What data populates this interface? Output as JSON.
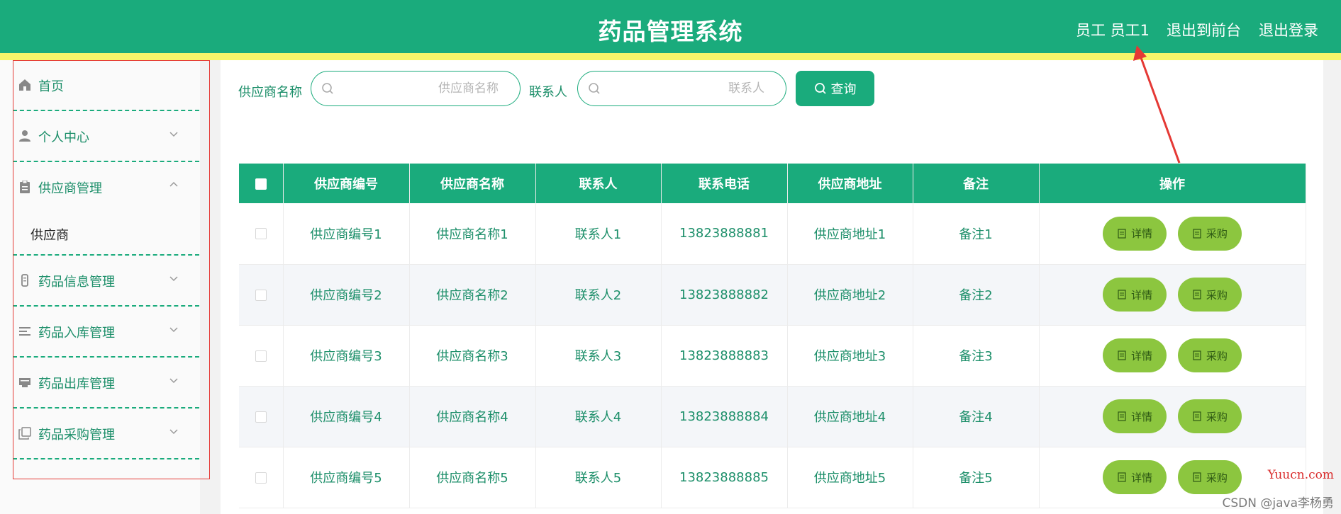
{
  "header": {
    "title": "药品管理系统",
    "user_label": "员工 员工1",
    "front_link": "退出到前台",
    "logout_link": "退出登录"
  },
  "sidebar": {
    "items": [
      {
        "label": "首页",
        "icon": "home-icon"
      },
      {
        "label": "个人中心",
        "icon": "user-icon"
      },
      {
        "label": "供应商管理",
        "icon": "clipboard-icon",
        "expanded": true
      },
      {
        "label": "药品信息管理",
        "icon": "vial-icon"
      },
      {
        "label": "药品入库管理",
        "icon": "list-icon"
      },
      {
        "label": "药品出库管理",
        "icon": "box-icon"
      },
      {
        "label": "药品采购管理",
        "icon": "copy-icon"
      }
    ],
    "submenu_label": "供应商"
  },
  "search": {
    "supplier_label": "供应商名称",
    "supplier_placeholder": "供应商名称",
    "contact_label": "联系人",
    "contact_placeholder": "联系人",
    "query_label": "查询"
  },
  "table": {
    "columns": [
      "供应商编号",
      "供应商名称",
      "联系人",
      "联系电话",
      "供应商地址",
      "备注",
      "操作"
    ],
    "rows": [
      [
        "供应商编号1",
        "供应商名称1",
        "联系人1",
        "13823888881",
        "供应商地址1",
        "备注1"
      ],
      [
        "供应商编号2",
        "供应商名称2",
        "联系人2",
        "13823888882",
        "供应商地址2",
        "备注2"
      ],
      [
        "供应商编号3",
        "供应商名称3",
        "联系人3",
        "13823888883",
        "供应商地址3",
        "备注3"
      ],
      [
        "供应商编号4",
        "供应商名称4",
        "联系人4",
        "13823888884",
        "供应商地址4",
        "备注4"
      ],
      [
        "供应商编号5",
        "供应商名称5",
        "联系人5",
        "13823888885",
        "供应商地址5",
        "备注5"
      ]
    ],
    "detail_label": "详情",
    "purchase_label": "采购"
  },
  "watermark": {
    "site": "Yuucn.com",
    "author": "CSDN @java李杨勇"
  },
  "colors": {
    "primary": "#1aab7c",
    "accent_bar": "#f8f56a",
    "action_button": "#8cc63f",
    "annotation": "#e53935"
  }
}
